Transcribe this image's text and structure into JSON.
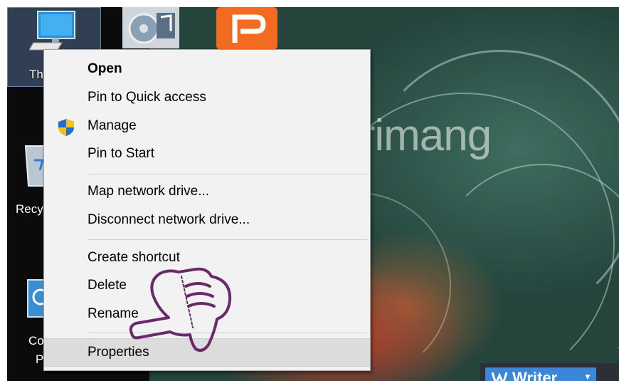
{
  "desktop_icons": {
    "this_pc": {
      "label": "Th",
      "icon": "computer-icon"
    },
    "recycle_bin": {
      "label": "Recy",
      "icon": "recycle-bin-icon"
    },
    "control_panel": {
      "label_line1": "Co",
      "label_line2": "P",
      "icon": "control-panel-icon"
    },
    "media_app": {
      "icon": "media-player-icon"
    },
    "p_app": {
      "icon": "p-app-icon",
      "color": "#f26b21"
    }
  },
  "context_menu": {
    "groups": [
      [
        {
          "label": "Open",
          "bold": true
        },
        {
          "label": "Pin to Quick access"
        },
        {
          "label": "Manage",
          "icon": "uac-shield-icon"
        },
        {
          "label": "Pin to Start"
        }
      ],
      [
        {
          "label": "Map network drive..."
        },
        {
          "label": "Disconnect network drive..."
        }
      ],
      [
        {
          "label": "Create shortcut"
        },
        {
          "label": "Delete"
        },
        {
          "label": "Rename"
        }
      ],
      [
        {
          "label": "Properties",
          "highlighted": true
        }
      ]
    ]
  },
  "watermark": {
    "text": "uantrimang",
    "icon": "lightbulb-logo-icon"
  },
  "writer_button": {
    "label": "Writer",
    "icon": "writer-w-icon",
    "color": "#3b86d6"
  },
  "overlay": {
    "icon": "pointing-hand-icon",
    "color": "#6a2a6a"
  }
}
